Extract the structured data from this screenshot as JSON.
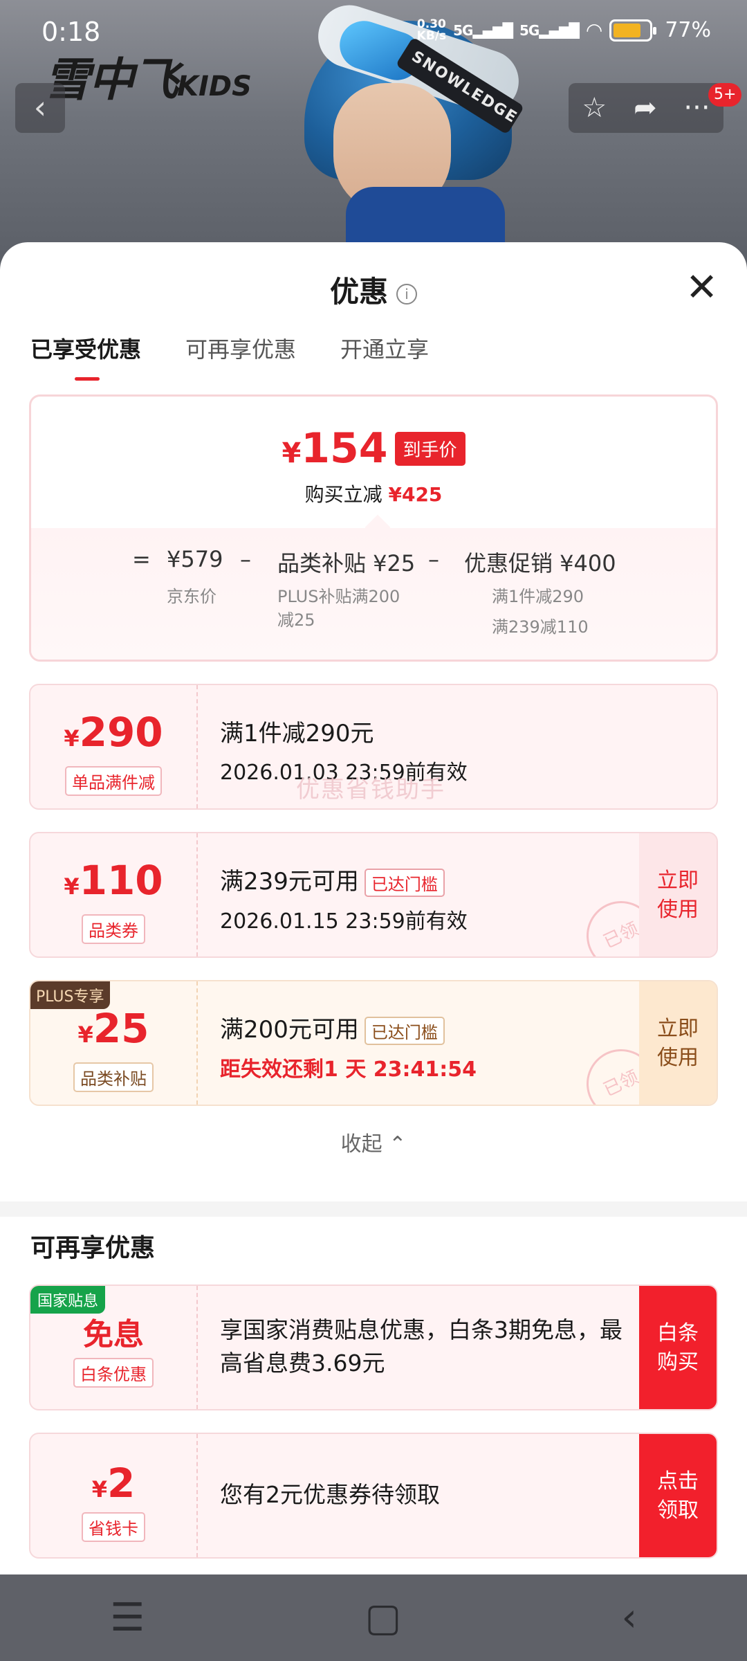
{
  "status": {
    "time": "0:18",
    "net_speed": "0.30",
    "net_unit": "KB/s",
    "sig1": "5G",
    "sig2": "5G",
    "battery_pct": "77%",
    "battery_level": 0.77
  },
  "hero": {
    "brand": "雪中飞",
    "brand_suffix": "KIDS",
    "strap_text": "SNOWLEDGE",
    "msg_badge": "5+"
  },
  "sheet": {
    "title": "优惠",
    "tabs": [
      {
        "label": "已享受优惠"
      },
      {
        "label": "可再享优惠"
      },
      {
        "label": "开通立享"
      }
    ]
  },
  "summary": {
    "final_price_symbol": "¥",
    "final_price": "154",
    "final_tag": "到手价",
    "saving_label": "购买立减",
    "saving_value": "¥425",
    "eq": "=",
    "list_price": "¥579",
    "list_label": "京东价",
    "minus1": "–",
    "subsidy": "品类补贴 ¥25",
    "subsidy_note_1": "PLUS补贴满200",
    "subsidy_note_2": "减25",
    "minus2": "–",
    "promo": "优惠促销 ¥400",
    "promo_note_1": "满1件减290",
    "promo_note_2": "满239减110"
  },
  "coupons": [
    {
      "symbol": "¥",
      "amount": "290",
      "kind": "单品满件减",
      "title": "满1件减290元",
      "detail": "2026.01.03 23:59前有效",
      "watermark": "优惠省钱助手"
    },
    {
      "symbol": "¥",
      "amount": "110",
      "kind": "品类券",
      "title": "满239元可用",
      "badge": "已达门槛",
      "detail": "2026.01.15 23:59前有效",
      "side_1": "立即",
      "side_2": "使用",
      "stamp": "已领"
    },
    {
      "plus_tag": "PLUS专享",
      "symbol": "¥",
      "amount": "25",
      "kind": "品类补贴",
      "title": "满200元可用",
      "badge": "已达门槛",
      "detail": "距失效还剩1 天 23:41:54",
      "side_1": "立即",
      "side_2": "使用",
      "stamp": "已领"
    }
  ],
  "collapse_label": "收起 ⌃",
  "more": {
    "title": "可再享优惠",
    "items": [
      {
        "tag": "国家贴息",
        "amount": "免息",
        "kind": "白条优惠",
        "text": "享国家消费贴息优惠，白条3期免息，最高省息费3.69元",
        "side_1": "白条",
        "side_2": "购买"
      },
      {
        "symbol": "¥",
        "amount": "2",
        "kind": "省钱卡",
        "text": "您有2元优惠券待领取",
        "side_1": "点击",
        "side_2": "领取"
      }
    ]
  },
  "icons": {
    "back": "chevron-left-icon",
    "star": "star-icon",
    "share": "share-icon",
    "more": "more-dots-icon",
    "info": "info-icon",
    "close": "close-icon",
    "menu": "menu-icon",
    "home": "home-icon",
    "nav_back": "back-icon"
  },
  "colors": {
    "accent": "#e8242c",
    "plus_brown": "#5b3b2a",
    "gov_green": "#16a34a"
  }
}
